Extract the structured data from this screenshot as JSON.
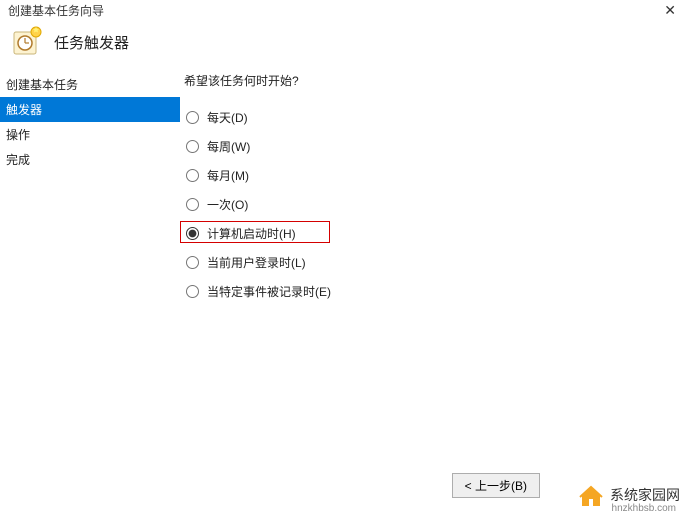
{
  "titlebar": {
    "title": "创建基本任务向导"
  },
  "header": {
    "title": "任务触发器"
  },
  "sidebar": {
    "items": [
      {
        "label": "创建基本任务",
        "active": false
      },
      {
        "label": "触发器",
        "active": true
      },
      {
        "label": "操作",
        "active": false
      },
      {
        "label": "完成",
        "active": false
      }
    ]
  },
  "main": {
    "prompt": "希望该任务何时开始?",
    "options": [
      {
        "label": "每天(D)",
        "checked": false
      },
      {
        "label": "每周(W)",
        "checked": false
      },
      {
        "label": "每月(M)",
        "checked": false
      },
      {
        "label": "一次(O)",
        "checked": false
      },
      {
        "label": "计算机启动时(H)",
        "checked": true,
        "highlight": true
      },
      {
        "label": "当前用户登录时(L)",
        "checked": false
      },
      {
        "label": "当特定事件被记录时(E)",
        "checked": false
      }
    ]
  },
  "footer": {
    "back": "< 上一步(B)"
  },
  "watermark": {
    "main": "系统家园网",
    "sub": "hnzkhbsb.com"
  }
}
